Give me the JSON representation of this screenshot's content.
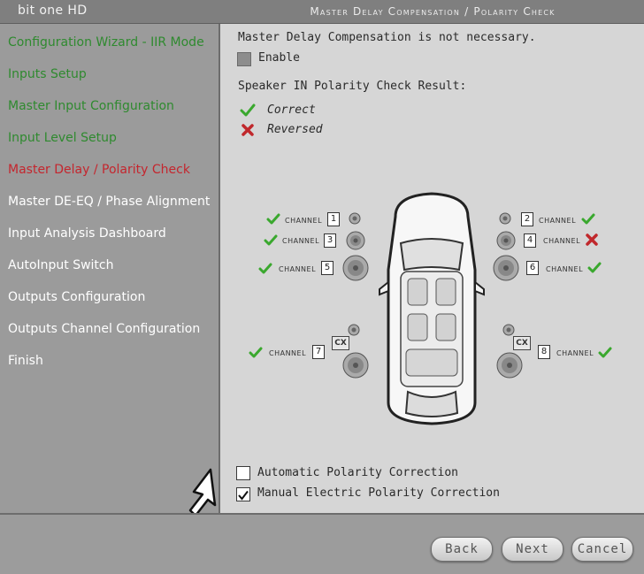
{
  "app": {
    "title": "bit one HD"
  },
  "header": {
    "page_title": "Master Delay Compensation / Polarity Check"
  },
  "sidebar": {
    "items": [
      {
        "label": "Configuration Wizard - IIR Mode",
        "state": "done"
      },
      {
        "label": "Inputs Setup",
        "state": "done"
      },
      {
        "label": "Master Input Configuration",
        "state": "done"
      },
      {
        "label": "Input Level Setup",
        "state": "done"
      },
      {
        "label": "Master Delay / Polarity Check",
        "state": "active"
      },
      {
        "label": "Master DE-EQ / Phase Alignment",
        "state": "pending"
      },
      {
        "label": "Input Analysis Dashboard",
        "state": "pending"
      },
      {
        "label": "AutoInput Switch",
        "state": "pending"
      },
      {
        "label": "Outputs Configuration",
        "state": "pending"
      },
      {
        "label": "Outputs Channel Configuration",
        "state": "pending"
      },
      {
        "label": "Finish",
        "state": "pending"
      }
    ]
  },
  "main": {
    "delay_message": "Master Delay Compensation is not necessary.",
    "enable": {
      "label": "Enable",
      "checked": false,
      "disabled": true
    },
    "result_heading": "Speaker IN Polarity Check Result:",
    "legend": {
      "correct": "Correct",
      "reversed": "Reversed"
    },
    "channel_word": "CHANNEL",
    "channels": [
      {
        "number": "1",
        "status": "correct"
      },
      {
        "number": "2",
        "status": "correct"
      },
      {
        "number": "3",
        "status": "correct"
      },
      {
        "number": "4",
        "status": "reversed"
      },
      {
        "number": "5",
        "status": "correct"
      },
      {
        "number": "6",
        "status": "correct"
      },
      {
        "number": "7",
        "status": "correct"
      },
      {
        "number": "8",
        "status": "correct"
      }
    ],
    "crossover_label": "CX",
    "auto_correction": {
      "label": "Automatic Polarity Correction",
      "checked": false
    },
    "manual_correction": {
      "label": "Manual Electric Polarity Correction",
      "checked": true
    }
  },
  "footer": {
    "back": "Back",
    "next": "Next",
    "cancel": "Cancel"
  },
  "colors": {
    "done": "#2f8a2f",
    "active": "#c4262e",
    "pending": "#ffffff",
    "correct": "#3aa82e",
    "reversed": "#c0282c"
  }
}
